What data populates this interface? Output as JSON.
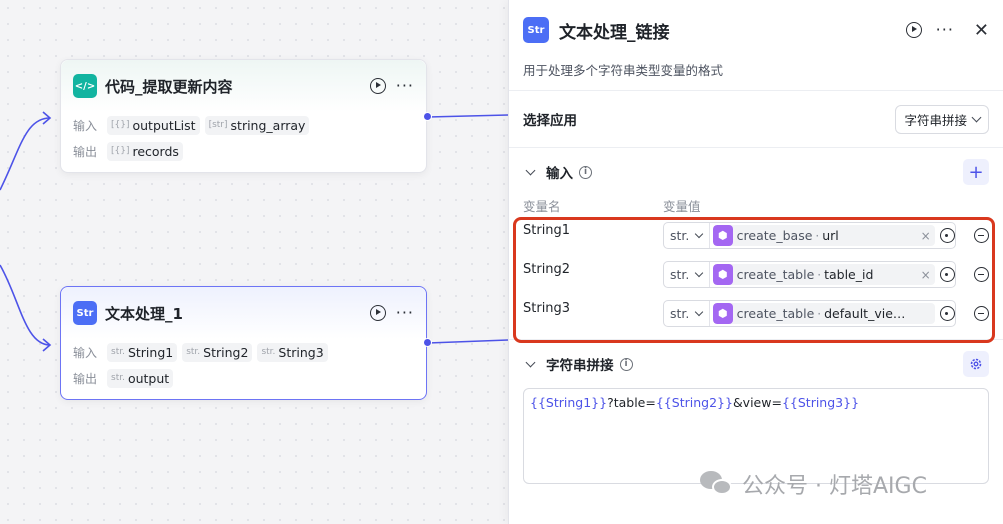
{
  "nodes": {
    "code": {
      "icon": "code-icon",
      "title": "代码_提取更新内容",
      "input_label": "输入",
      "output_label": "输出",
      "inputs": [
        {
          "type": "[{}]",
          "name": "outputList"
        },
        {
          "type": "[str]",
          "name": "string_array"
        }
      ],
      "outputs": [
        {
          "type": "[{}]",
          "name": "records"
        }
      ]
    },
    "text1": {
      "icon": "text-process-icon",
      "title": "文本处理_1",
      "input_label": "输入",
      "output_label": "输出",
      "inputs": [
        {
          "type": "str.",
          "name": "String1"
        },
        {
          "type": "str.",
          "name": "String2"
        },
        {
          "type": "str.",
          "name": "String3"
        }
      ],
      "outputs": [
        {
          "type": "str.",
          "name": "output"
        }
      ]
    }
  },
  "panel": {
    "title": "文本处理_链接",
    "description": "用于处理多个字符串类型变量的格式",
    "select_app_label": "选择应用",
    "select_app_value": "字符串拼接",
    "input_section": {
      "title": "输入",
      "col_name": "变量名",
      "col_value": "变量值",
      "rows": [
        {
          "name": "String1",
          "type": "str.",
          "source": "create_base",
          "var": "url"
        },
        {
          "name": "String2",
          "type": "str.",
          "source": "create_table",
          "var": "table_id"
        },
        {
          "name": "String3",
          "type": "str.",
          "source": "create_table",
          "var": "default_vie…"
        }
      ]
    },
    "concat_section": {
      "title": "字符串拼接",
      "template": [
        {
          "t": "{{String1}}",
          "var": true
        },
        {
          "t": "?table=",
          "var": false
        },
        {
          "t": "{{String2}}",
          "var": true
        },
        {
          "t": "&view=",
          "var": false
        },
        {
          "t": "{{String3}}",
          "var": true
        }
      ]
    }
  },
  "watermark": "公众号 · 灯塔AIGC",
  "colors": {
    "accent": "#4d53e8",
    "highlight": "#d9381e",
    "code_icon": "#12b4a0",
    "text_icon": "#4c6ef5",
    "ref_icon": "#a467f2"
  }
}
